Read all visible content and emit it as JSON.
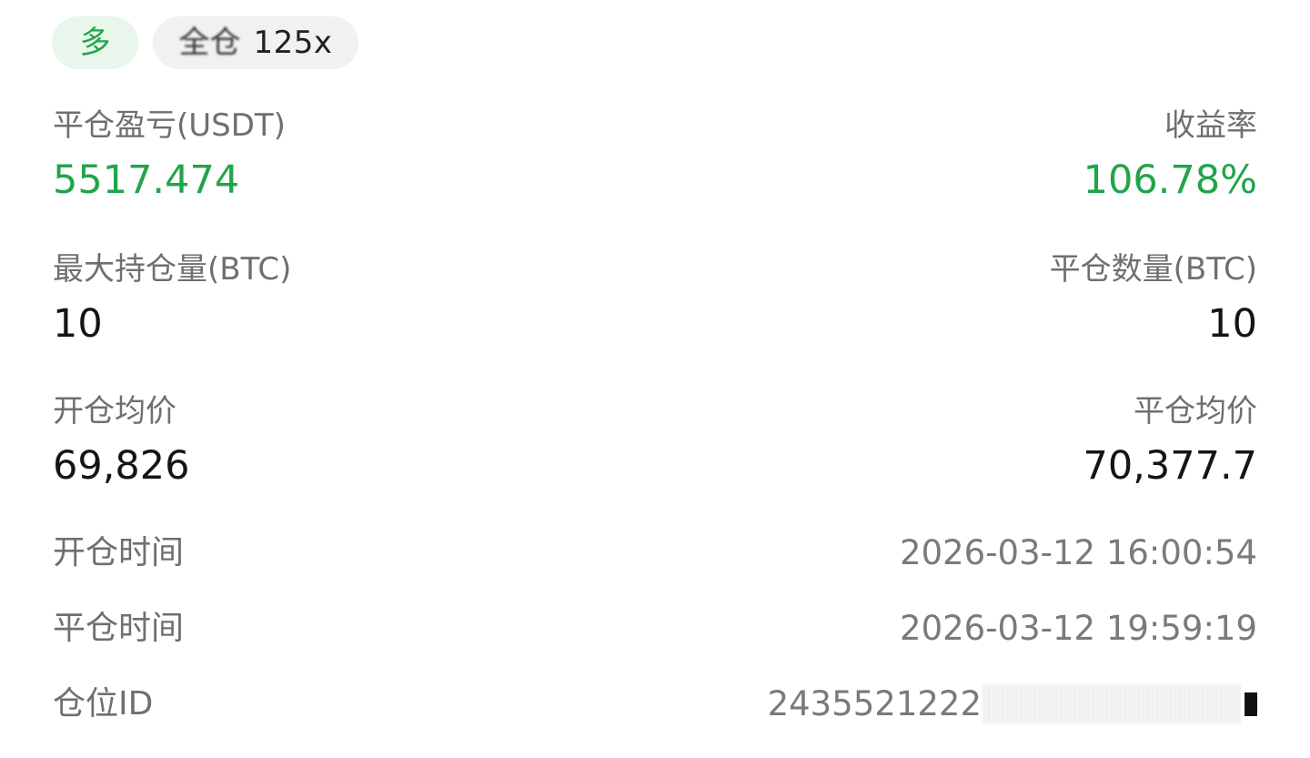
{
  "tags": {
    "direction": "多",
    "margin_mode": "全仓",
    "leverage": "125x"
  },
  "colors": {
    "profit": "#22a44a",
    "label": "#6f6f6f",
    "muted_value": "#7a7a7a",
    "primary_text": "#141414"
  },
  "summary": {
    "pnl_label": "平仓盈亏(USDT)",
    "pnl_value": "5517.474",
    "roi_label": "收益率",
    "roi_value": "106.78%",
    "max_position_label": "最大持仓量(BTC)",
    "max_position_value": "10",
    "close_qty_label": "平仓数量(BTC)",
    "close_qty_value": "10",
    "avg_open_label": "开仓均价",
    "avg_open_value": "69,826",
    "avg_close_label": "平仓均价",
    "avg_close_value": "70,377.7"
  },
  "details": {
    "open_time_label": "开仓时间",
    "open_time_value": "2026-03-12 16:00:54",
    "close_time_label": "平仓时间",
    "close_time_value": "2026-03-12 19:59:19",
    "position_id_label": "仓位ID",
    "position_id_value": "2435521222"
  }
}
